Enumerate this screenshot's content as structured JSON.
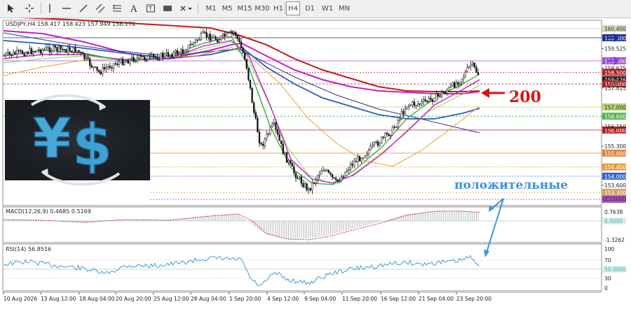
{
  "toolbar": {
    "timeframes": [
      "M1",
      "M5",
      "M15",
      "M30",
      "H1",
      "H4",
      "D1",
      "W1",
      "MN"
    ],
    "active_timeframe": "H4",
    "icons": [
      "cursor-icon",
      "crosshair-icon",
      "vertical-line-icon",
      "horizontal-line-icon",
      "trendline-icon",
      "channel-icon",
      "fibonacci-icon",
      "text-icon",
      "text-label-icon",
      "rectangle-shape-icon",
      "arrows-icon"
    ]
  },
  "main_chart": {
    "header": "USDJPY,H4  158.417 158.423 157.949 158.176"
  },
  "price_axis": {
    "plain": [
      "159.525",
      "158.675",
      "157.825",
      "156.150",
      "155.300",
      "153.600",
      "153.000"
    ],
    "levels": [
      {
        "value": "160.400",
        "bg": "#d9d9b0",
        "fg": "#333333"
      },
      {
        "value": "160.000",
        "bg": "#1f2f8f",
        "fg": "#ffffff"
      },
      {
        "value": "159.000",
        "bg": "#9e4fd3",
        "fg": "#ffffff"
      },
      {
        "value": "158.500",
        "bg": "#c11c1c",
        "fg": "#ffffff"
      },
      {
        "value": "158.176",
        "bg": "#222222",
        "fg": "#ffffff"
      },
      {
        "value": "158.000",
        "bg": "#b02020",
        "fg": "#ffffff"
      },
      {
        "value": "157.000",
        "bg": "#b5d36a",
        "fg": "#333333"
      },
      {
        "value": "156.600",
        "bg": "#4eb84e",
        "fg": "#ffffff"
      },
      {
        "value": "156.000",
        "bg": "#b51f1f",
        "fg": "#ffffff"
      },
      {
        "value": "155.000",
        "bg": "#e0843a",
        "fg": "#ffffff"
      },
      {
        "value": "154.400",
        "bg": "#e89a3c",
        "fg": "#ffffff"
      },
      {
        "value": "154.000",
        "bg": "#3064d6",
        "fg": "#ffffff"
      },
      {
        "value": "153.300",
        "bg": "#d3a05a",
        "fg": "#ffffff"
      },
      {
        "value": "153.000",
        "bg": "#a13ab0",
        "fg": "#ffffff"
      }
    ]
  },
  "annotations": {
    "ma_label": "200",
    "positive_label": "положительные"
  },
  "macd": {
    "header": "MACD(12,26,9) 0.4685 0.5169",
    "axis": [
      "0.7638",
      "0.0000",
      "-1.3262"
    ]
  },
  "rsi": {
    "header": "RSI(14) 56.8516",
    "axis": [
      "100",
      "70",
      "50.0000",
      "30",
      "0"
    ]
  },
  "time_axis": {
    "labels": [
      "10 Aug 2026",
      "13 Aug 12:00",
      "18 Aug 04:00",
      "20 Aug 20:00",
      "25 Aug 12:00",
      "28 Aug 04:00",
      "1 Sep 20:00",
      "4 Sep 12:00",
      "9 Sep 04:00",
      "11 Sep 20:00",
      "16 Sep 12:00",
      "21 Sep 04:00",
      "23 Sep 20:00"
    ]
  },
  "colors": {
    "ma_red": "#c41a1a",
    "ma_magenta": "#c81fbf",
    "ma_blue": "#2a5bc4",
    "ma_darkblue": "#303090",
    "ma_green": "#2ea82e",
    "ma_lime": "#8fd35a",
    "ma_orange": "#e0a040",
    "annotation_blue": "#3f8fe0",
    "annotation_red": "#e01010"
  }
}
